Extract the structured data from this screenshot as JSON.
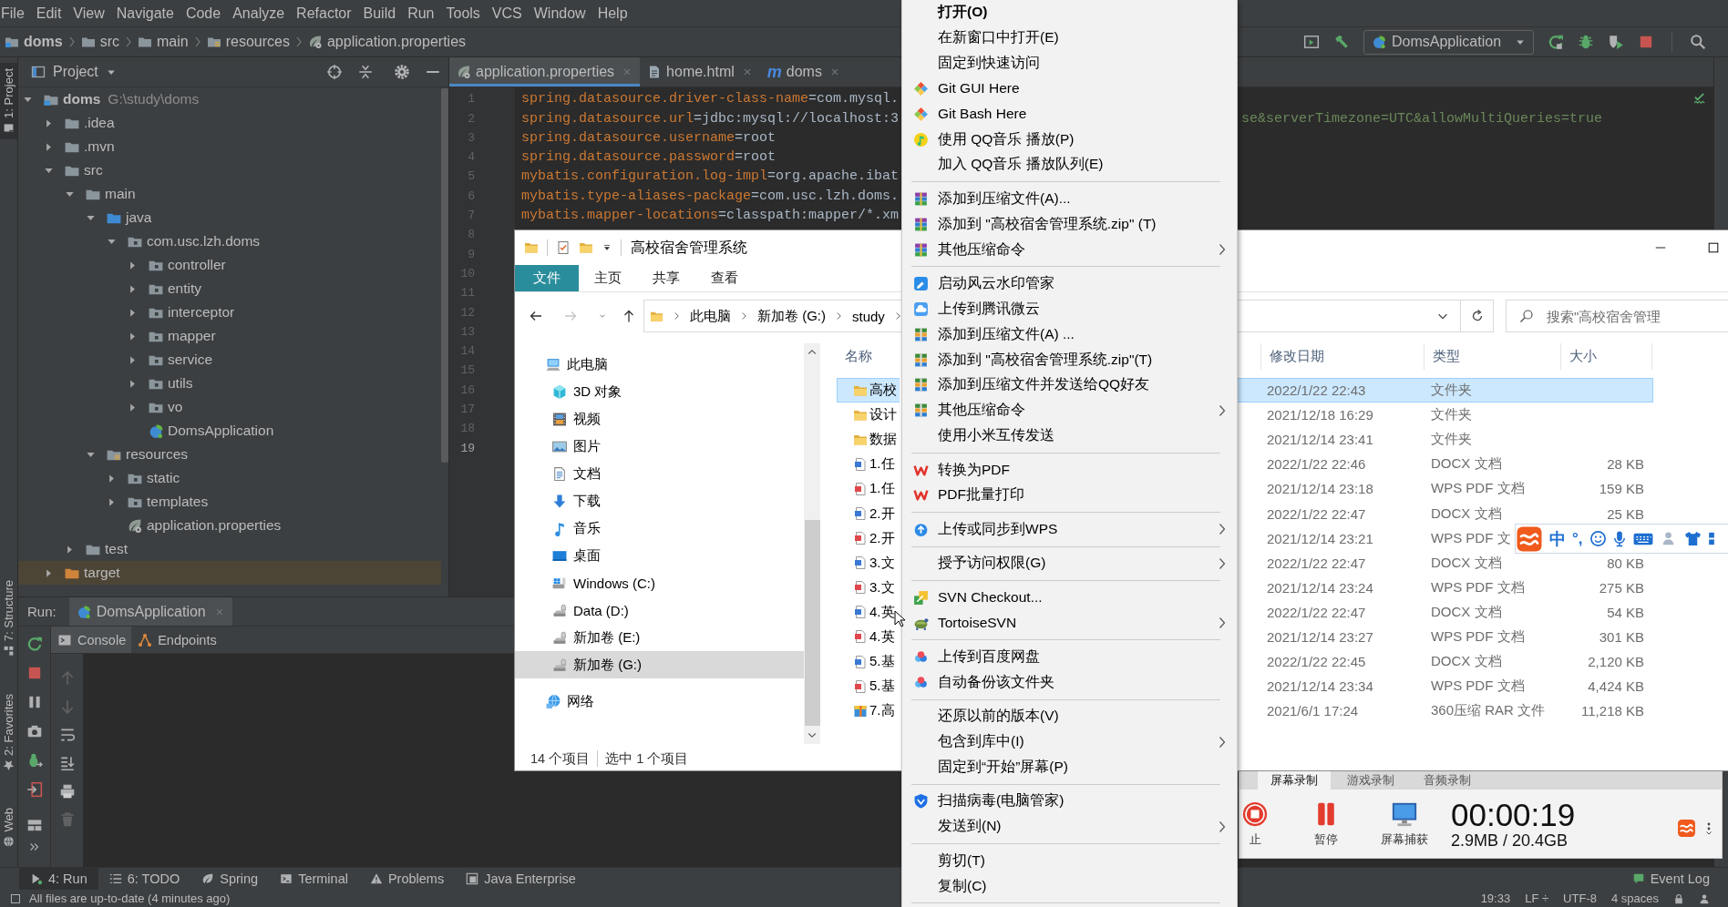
{
  "ide": {
    "menu_bar": [
      "File",
      "Edit",
      "View",
      "Navigate",
      "Code",
      "Analyze",
      "Refactor",
      "Build",
      "Run",
      "Tools",
      "VCS",
      "Window",
      "Help"
    ],
    "breadcrumb": [
      {
        "label": "doms",
        "kind": "module"
      },
      {
        "label": "src",
        "kind": "folder"
      },
      {
        "label": "main",
        "kind": "folder"
      },
      {
        "label": "resources",
        "kind": "resources"
      },
      {
        "label": "application.properties",
        "kind": "properties"
      }
    ],
    "toolbar": {
      "run_config": "DomsApplication"
    },
    "side_tabs": [
      {
        "label": "1: Project",
        "kind": "project",
        "selected": true
      },
      {
        "label": "7: Structure",
        "kind": "structure",
        "selected": false
      },
      {
        "label": "2: Favorites",
        "kind": "favorites",
        "selected": false
      },
      {
        "label": "Web",
        "kind": "web",
        "selected": false
      }
    ],
    "project_panel": {
      "title": "Project",
      "tree": [
        {
          "label": "doms",
          "path": "G:\\study\\doms",
          "kind": "module",
          "expanded": true,
          "children": [
            {
              "label": ".idea",
              "kind": "folder",
              "expanded": false
            },
            {
              "label": ".mvn",
              "kind": "folder",
              "expanded": false
            },
            {
              "label": "src",
              "kind": "folder",
              "expanded": true,
              "children": [
                {
                  "label": "main",
                  "kind": "folder",
                  "expanded": true,
                  "children": [
                    {
                      "label": "java",
                      "kind": "source",
                      "expanded": true,
                      "children": [
                        {
                          "label": "com.usc.lzh.doms",
                          "kind": "package",
                          "expanded": true,
                          "children": [
                            {
                              "label": "controller",
                              "kind": "package",
                              "expanded": false
                            },
                            {
                              "label": "entity",
                              "kind": "package",
                              "expanded": false
                            },
                            {
                              "label": "interceptor",
                              "kind": "package",
                              "expanded": false
                            },
                            {
                              "label": "mapper",
                              "kind": "package",
                              "expanded": false
                            },
                            {
                              "label": "service",
                              "kind": "package",
                              "expanded": false
                            },
                            {
                              "label": "utils",
                              "kind": "package",
                              "expanded": false
                            },
                            {
                              "label": "vo",
                              "kind": "package",
                              "expanded": false
                            },
                            {
                              "label": "DomsApplication",
                              "kind": "spring"
                            }
                          ]
                        }
                      ]
                    },
                    {
                      "label": "resources",
                      "kind": "resources",
                      "expanded": true,
                      "children": [
                        {
                          "label": "static",
                          "kind": "package",
                          "expanded": false
                        },
                        {
                          "label": "templates",
                          "kind": "package",
                          "expanded": false
                        },
                        {
                          "label": "application.properties",
                          "kind": "properties"
                        }
                      ]
                    }
                  ]
                },
                {
                  "label": "test",
                  "kind": "folder",
                  "expanded": false
                }
              ]
            },
            {
              "label": "target",
              "kind": "excluded",
              "expanded": false
            }
          ]
        }
      ]
    },
    "editor_tabs": [
      {
        "label": "application.properties",
        "kind": "properties",
        "selected": true
      },
      {
        "label": "home.html",
        "kind": "html",
        "selected": false
      },
      {
        "label": "doms",
        "kind": "maven",
        "glyph": "m",
        "selected": false
      }
    ],
    "code_lines": [
      {
        "number": "1",
        "key": "spring.datasource.driver-class-name",
        "value": "=com.mysql.",
        "current": false
      },
      {
        "number": "2",
        "key": "spring.datasource.url",
        "value": "=jdbc:mysql://localhost:3",
        "more": "se&serverTimezone=UTC&allowMultiQueries=true",
        "current": false
      },
      {
        "number": "3",
        "key": "spring.datasource.username",
        "value": "=root",
        "current": false
      },
      {
        "number": "4",
        "key": "spring.datasource.password",
        "value": "=root",
        "current": false
      },
      {
        "number": "5",
        "key": "mybatis.configuration.log-impl",
        "value": "=org.apache.ibat",
        "current": false
      },
      {
        "number": "6",
        "key": "mybatis.type-aliases-package",
        "value": "=com.usc.lzh.doms.",
        "current": false
      },
      {
        "number": "7",
        "key": "mybatis.mapper-locations",
        "value": "=classpath:mapper/*.xm",
        "current": false
      },
      {
        "number": "8",
        "current": false
      },
      {
        "number": "9",
        "current": false
      },
      {
        "number": "10",
        "current": false
      },
      {
        "number": "11",
        "current": false
      },
      {
        "number": "12",
        "current": false
      },
      {
        "number": "13",
        "current": false
      },
      {
        "number": "14",
        "current": false
      },
      {
        "number": "15",
        "current": false
      },
      {
        "number": "16",
        "current": false
      },
      {
        "number": "17",
        "current": false
      },
      {
        "number": "18",
        "current": false
      },
      {
        "number": "19",
        "current": true
      }
    ],
    "run_panel": {
      "title": "Run:",
      "config": "DomsApplication",
      "tabs": [
        {
          "label": "Console",
          "kind": "console",
          "selected": true
        },
        {
          "label": "Endpoints",
          "kind": "endpoints",
          "selected": false
        }
      ]
    },
    "tool_strip": [
      {
        "label": "4: Run",
        "kind": "run",
        "selected": true
      },
      {
        "label": "6: TODO",
        "kind": "todo",
        "selected": false
      },
      {
        "label": "Spring",
        "kind": "leaf",
        "selected": false
      },
      {
        "label": "Terminal",
        "kind": "terminal",
        "selected": false
      },
      {
        "label": "Problems",
        "kind": "problems",
        "selected": false
      },
      {
        "label": "Java Enterprise",
        "kind": "enterprise",
        "selected": false
      }
    ],
    "event_log": "Event Log",
    "status_bar": {
      "message": "All files are up-to-date (4 minutes ago)",
      "items": [
        "19:33",
        "LF ÷",
        "UTF-8",
        "4 spaces"
      ]
    }
  },
  "explorer": {
    "title": "高校宿舍管理系统",
    "ribbon_tabs": [
      {
        "label": "文件",
        "selected": true
      },
      {
        "label": "主页",
        "selected": false
      },
      {
        "label": "共享",
        "selected": false
      },
      {
        "label": "查看",
        "selected": false
      }
    ],
    "address": [
      "此电脑",
      "新加卷 (G:)",
      "study"
    ],
    "search": {
      "placeholder": "搜索\"高校宿舍管理"
    },
    "nav_pane": [
      {
        "label": "此电脑",
        "kind": "pc",
        "selected": false,
        "children": [
          {
            "label": "3D 对象",
            "kind": "cube",
            "selected": false
          },
          {
            "label": "视频",
            "kind": "video",
            "selected": false
          },
          {
            "label": "图片",
            "kind": "pictures",
            "selected": false
          },
          {
            "label": "文档",
            "kind": "documents",
            "selected": false
          },
          {
            "label": "下载",
            "kind": "downloads",
            "selected": false
          },
          {
            "label": "音乐",
            "kind": "music",
            "selected": false
          },
          {
            "label": "桌面",
            "kind": "desktop",
            "selected": false
          },
          {
            "label": "Windows (C:)",
            "kind": "sysdrive",
            "selected": false
          },
          {
            "label": "Data (D:)",
            "kind": "drive",
            "selected": false
          },
          {
            "label": "新加卷 (E:)",
            "kind": "drive",
            "selected": false
          },
          {
            "label": "新加卷 (G:)",
            "kind": "drive",
            "selected": true
          }
        ]
      },
      {
        "label": "网络",
        "kind": "network",
        "selected": false
      }
    ],
    "columns": [
      "名称",
      "修改日期",
      "类型",
      "大小"
    ],
    "rows": [
      {
        "name": "高校",
        "kind": "yfolder",
        "modified": "2022/1/22 22:43",
        "type": "文件夹",
        "selected": true
      },
      {
        "name": "设计",
        "kind": "yfolder",
        "modified": "2021/12/18 16:29",
        "type": "文件夹",
        "selected": false
      },
      {
        "name": "数据",
        "kind": "yfolder",
        "modified": "2021/12/14 23:41",
        "type": "文件夹",
        "selected": false
      },
      {
        "name": "1.任",
        "kind": "docx",
        "modified": "2022/1/22 22:46",
        "type": "DOCX 文档",
        "size": "28 KB",
        "selected": false
      },
      {
        "name": "1.任",
        "kind": "pdf",
        "modified": "2021/12/14 23:18",
        "type": "WPS PDF 文档",
        "size": "159 KB",
        "selected": false
      },
      {
        "name": "2.开",
        "kind": "docx",
        "modified": "2022/1/22 22:47",
        "type": "DOCX 文档",
        "size": "25 KB",
        "selected": false
      },
      {
        "name": "2.开",
        "kind": "pdf",
        "modified": "2021/12/14 23:21",
        "type": "WPS PDF 文",
        "selected": false
      },
      {
        "name": "3.文",
        "kind": "docx",
        "modified": "2022/1/22 22:47",
        "type": "DOCX 文档",
        "size": "80 KB",
        "selected": false
      },
      {
        "name": "3.文",
        "kind": "pdf",
        "modified": "2021/12/14 23:24",
        "type": "WPS PDF 文档",
        "size": "275 KB",
        "selected": false
      },
      {
        "name": "4.英",
        "kind": "docx",
        "modified": "2022/1/22 22:47",
        "type": "DOCX 文档",
        "size": "54 KB",
        "selected": false
      },
      {
        "name": "4.英",
        "kind": "pdf",
        "modified": "2021/12/14 23:27",
        "type": "WPS PDF 文档",
        "size": "301 KB",
        "selected": false
      },
      {
        "name": "5.基",
        "kind": "docx",
        "modified": "2022/1/22 22:45",
        "type": "DOCX 文档",
        "size": "2,120 KB",
        "selected": false
      },
      {
        "name": "5.基",
        "kind": "pdf",
        "modified": "2021/12/14 23:34",
        "type": "WPS PDF 文档",
        "size": "4,424 KB",
        "selected": false
      },
      {
        "name": "7.高",
        "kind": "rar",
        "modified": "2021/6/1 17:24",
        "type": "360压缩 RAR 文件",
        "size": "11,218 KB",
        "selected": false
      }
    ],
    "status": [
      "14 个项目",
      "选中 1 个项目"
    ]
  },
  "context_menu": [
    {
      "label": "打开(O)",
      "kind": "default",
      "submenu": false
    },
    {
      "label": "在新窗口中打开(E)",
      "kind": "plain",
      "submenu": false
    },
    {
      "label": "固定到快速访问",
      "kind": "plain",
      "submenu": false
    },
    {
      "label": "Git GUI Here",
      "kind": "git",
      "submenu": false
    },
    {
      "label": "Git Bash Here",
      "kind": "git",
      "submenu": false
    },
    {
      "label": "使用 QQ音乐 播放(P)",
      "kind": "qqmusic",
      "submenu": false
    },
    {
      "label": "加入 QQ音乐 播放队列(E)",
      "kind": "plain",
      "submenu": false
    },
    {
      "kind": "separator"
    },
    {
      "label": "添加到压缩文件(A)...",
      "kind": "winrar",
      "submenu": false
    },
    {
      "label": "添加到 \"高校宿舍管理系统.zip\" (T)",
      "kind": "winrar",
      "submenu": false
    },
    {
      "label": "其他压缩命令",
      "kind": "winrar",
      "submenu": true
    },
    {
      "kind": "separator"
    },
    {
      "label": "启动风云水印管家",
      "kind": "watermark",
      "submenu": false
    },
    {
      "label": "上传到腾讯微云",
      "kind": "weiyun",
      "submenu": false
    },
    {
      "label": "添加到压缩文件(A) ...",
      "kind": "zip360",
      "submenu": false
    },
    {
      "label": "添加到 \"高校宿舍管理系统.zip\"(T)",
      "kind": "zip360",
      "submenu": false
    },
    {
      "label": "添加到压缩文件并发送给QQ好友",
      "kind": "zip360",
      "submenu": false
    },
    {
      "label": "其他压缩命令",
      "kind": "zip360",
      "submenu": true
    },
    {
      "label": "使用小米互传发送",
      "kind": "plain",
      "submenu": false
    },
    {
      "kind": "separator"
    },
    {
      "label": "转换为PDF",
      "kind": "wps",
      "submenu": false
    },
    {
      "label": "PDF批量打印",
      "kind": "wps",
      "submenu": false
    },
    {
      "kind": "separator"
    },
    {
      "label": "上传或同步到WPS",
      "kind": "wpscloud",
      "submenu": true
    },
    {
      "kind": "separator"
    },
    {
      "label": "授予访问权限(G)",
      "kind": "plain",
      "submenu": true
    },
    {
      "kind": "separator"
    },
    {
      "label": "SVN Checkout...",
      "kind": "svn",
      "submenu": false
    },
    {
      "label": "TortoiseSVN",
      "kind": "tortoise",
      "submenu": true
    },
    {
      "kind": "separator"
    },
    {
      "label": "上传到百度网盘",
      "kind": "baidu",
      "submenu": false
    },
    {
      "label": "自动备份该文件夹",
      "kind": "baidu",
      "submenu": false
    },
    {
      "kind": "separator"
    },
    {
      "label": "还原以前的版本(V)",
      "kind": "plain",
      "submenu": false
    },
    {
      "label": "包含到库中(I)",
      "kind": "plain",
      "submenu": true
    },
    {
      "label": "固定到“开始”屏幕(P)",
      "kind": "plain",
      "submenu": false
    },
    {
      "kind": "separator"
    },
    {
      "label": "扫描病毒(电脑管家)",
      "kind": "shield",
      "submenu": false
    },
    {
      "label": "发送到(N)",
      "kind": "plain",
      "submenu": true
    },
    {
      "kind": "separator"
    },
    {
      "label": "剪切(T)",
      "kind": "plain",
      "submenu": false
    },
    {
      "label": "复制(C)",
      "kind": "plain",
      "submenu": false
    },
    {
      "kind": "separator"
    }
  ],
  "recorder": {
    "tabs": [
      {
        "label": "屏幕录制",
        "selected": true
      },
      {
        "label": "游戏录制",
        "selected": false
      },
      {
        "label": "音频录制",
        "selected": false
      }
    ],
    "buttons": [
      {
        "label": "止",
        "kind": "stop"
      },
      {
        "label": "暂停",
        "kind": "pause"
      },
      {
        "label": "屏幕捕获",
        "kind": "capture"
      }
    ],
    "timer": "00:00:19",
    "size": "2.9MB / 20.4GB"
  },
  "ime_toolbar": {
    "mode": "中",
    "punctuation": "°,"
  }
}
